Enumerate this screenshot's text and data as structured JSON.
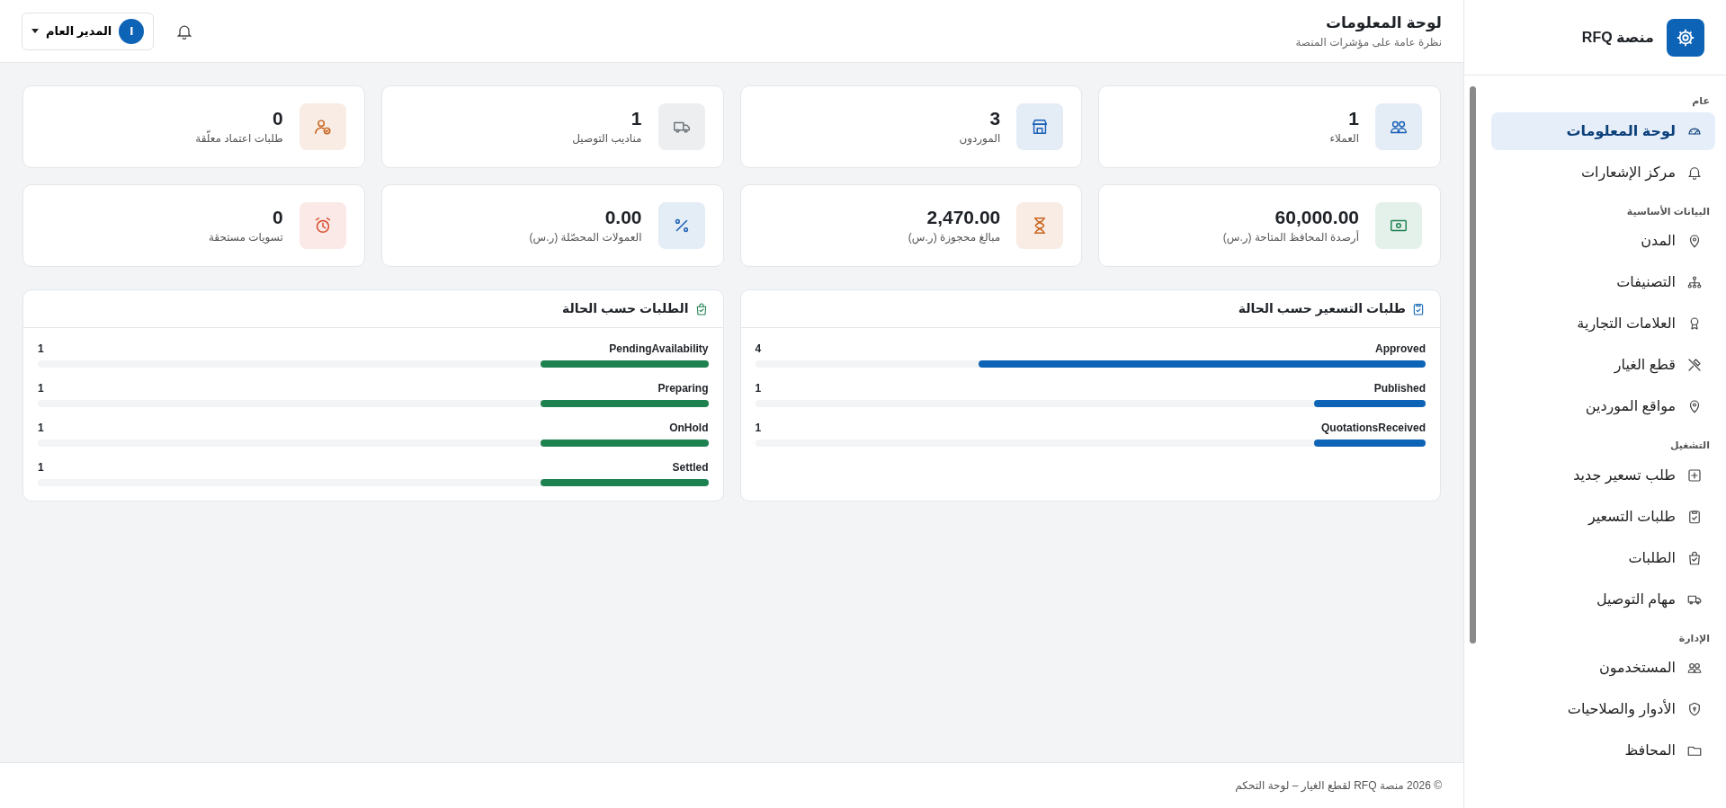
{
  "sidebar": {
    "brand": "منصة RFQ",
    "sections": [
      {
        "title": "عام",
        "items": [
          {
            "label": "لوحة المعلومات",
            "selected": true
          },
          {
            "label": "مركز الإشعارات",
            "selected": false
          }
        ]
      },
      {
        "title": "البيانات الأساسية",
        "items": [
          {
            "label": "المدن",
            "selected": false
          },
          {
            "label": "التصنيفات",
            "selected": false
          },
          {
            "label": "العلامات التجارية",
            "selected": false
          },
          {
            "label": "قطع الغيار",
            "selected": false
          },
          {
            "label": "مواقع الموردين",
            "selected": false
          }
        ]
      },
      {
        "title": "التشغيل",
        "items": [
          {
            "label": "طلب تسعير جديد",
            "selected": false
          },
          {
            "label": "طلبات التسعير",
            "selected": false
          },
          {
            "label": "الطلبات",
            "selected": false
          },
          {
            "label": "مهام التوصيل",
            "selected": false
          }
        ]
      },
      {
        "title": "الإدارة",
        "items": [
          {
            "label": "المستخدمون",
            "selected": false
          },
          {
            "label": "الأدوار والصلاحيات",
            "selected": false
          },
          {
            "label": "المحافظ",
            "selected": false
          }
        ]
      }
    ]
  },
  "header": {
    "title": "لوحة المعلومات",
    "subtitle": "نظرة عامة على مؤشرات المنصة",
    "user": {
      "initial": "ا",
      "name": "المدير العام"
    }
  },
  "stats": [
    {
      "value": "1",
      "label": "العملاء",
      "color": "#1a5fb4"
    },
    {
      "value": "3",
      "label": "الموردون",
      "color": "#1a5fb4"
    },
    {
      "value": "1",
      "label": "مناديب التوصيل",
      "color": "#6c757d"
    },
    {
      "value": "0",
      "label": "طلبات اعتماد معلّقة",
      "color": "#c8641e"
    },
    {
      "value": "60,000.00",
      "label": "أرصدة المحافظ المتاحة (ر.س)",
      "color": "#1e8150"
    },
    {
      "value": "2,470.00",
      "label": "مبالغ محجوزة (ر.س)",
      "color": "#c8641e"
    },
    {
      "value": "0.00",
      "label": "العمولات المحصّلة (ر.س)",
      "color": "#1a5fb4"
    },
    {
      "value": "0",
      "label": "تسويات مستحقة",
      "color": "#d9482b"
    }
  ],
  "panels": [
    {
      "title": "طلبات التسعير حسب الحالة",
      "color": "#0d63b5",
      "rows": [
        {
          "label": "Approved",
          "count": "4",
          "level": 0.667
        },
        {
          "label": "Published",
          "count": "1",
          "level": 0.167
        },
        {
          "label": "QuotationsReceived",
          "count": "1",
          "level": 0.167
        }
      ]
    },
    {
      "title": "الطلبات حسب الحالة",
      "color": "#1e8150",
      "rows": [
        {
          "label": "PendingAvailability",
          "count": "1",
          "level": 0.25
        },
        {
          "label": "Preparing",
          "count": "1",
          "level": 0.25
        },
        {
          "label": "OnHold",
          "count": "1",
          "level": 0.25
        },
        {
          "label": "Settled",
          "count": "1",
          "level": 0.25
        }
      ]
    }
  ],
  "footer": "© 2026 منصة RFQ لقطع الغيار – لوحة التحكم"
}
